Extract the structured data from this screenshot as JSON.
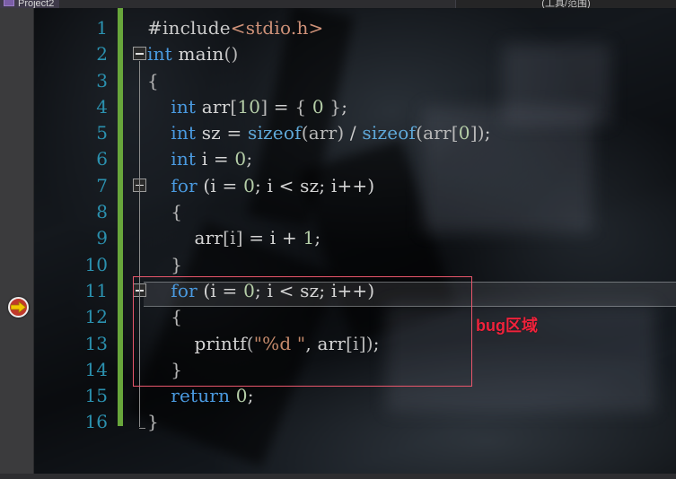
{
  "window": {
    "tab_label": "Project2",
    "tab_icon": "solution-icon",
    "right_panel_label": "(工具/范围)"
  },
  "editor": {
    "theme": "dark-with-background-image",
    "language": "C",
    "line_numbers": [
      "1",
      "2",
      "3",
      "4",
      "5",
      "6",
      "7",
      "8",
      "9",
      "10",
      "11",
      "12",
      "13",
      "14",
      "15",
      "16"
    ],
    "current_execution_line": 11,
    "breakpoint_line": 11,
    "lines": [
      {
        "n": 1,
        "indent": 0,
        "tokens": [
          {
            "t": "#include",
            "c": "pp"
          },
          {
            "t": "<stdio.h>",
            "c": "inc"
          }
        ]
      },
      {
        "n": 2,
        "indent": 0,
        "tokens": [
          {
            "t": "int",
            "c": "kw"
          },
          {
            "t": " ",
            "c": "plain"
          },
          {
            "t": "main",
            "c": "plain"
          },
          {
            "t": "()",
            "c": "brk"
          }
        ]
      },
      {
        "n": 3,
        "indent": 0,
        "tokens": [
          {
            "t": "{",
            "c": "brk"
          }
        ]
      },
      {
        "n": 4,
        "indent": 1,
        "tokens": [
          {
            "t": "int",
            "c": "kw"
          },
          {
            "t": " arr",
            "c": "plain"
          },
          {
            "t": "[",
            "c": "brk"
          },
          {
            "t": "10",
            "c": "num"
          },
          {
            "t": "]",
            "c": "brk"
          },
          {
            "t": " = ",
            "c": "op"
          },
          {
            "t": "{ ",
            "c": "brk"
          },
          {
            "t": "0",
            "c": "num"
          },
          {
            "t": " }",
            "c": "brk"
          },
          {
            "t": ";",
            "c": "op"
          }
        ]
      },
      {
        "n": 5,
        "indent": 1,
        "tokens": [
          {
            "t": "int",
            "c": "kw"
          },
          {
            "t": " sz = ",
            "c": "plain"
          },
          {
            "t": "sizeof",
            "c": "fn"
          },
          {
            "t": "(arr)",
            "c": "brk"
          },
          {
            "t": " / ",
            "c": "op"
          },
          {
            "t": "sizeof",
            "c": "fn"
          },
          {
            "t": "(arr",
            "c": "brk"
          },
          {
            "t": "[",
            "c": "brk"
          },
          {
            "t": "0",
            "c": "num"
          },
          {
            "t": "])",
            "c": "brk"
          },
          {
            "t": ";",
            "c": "op"
          }
        ]
      },
      {
        "n": 6,
        "indent": 1,
        "tokens": [
          {
            "t": "int",
            "c": "kw"
          },
          {
            "t": " i = ",
            "c": "plain"
          },
          {
            "t": "0",
            "c": "num"
          },
          {
            "t": ";",
            "c": "op"
          }
        ]
      },
      {
        "n": 7,
        "indent": 1,
        "tokens": [
          {
            "t": "for",
            "c": "kw"
          },
          {
            "t": " (i = ",
            "c": "plain"
          },
          {
            "t": "0",
            "c": "num"
          },
          {
            "t": "; i < sz; i++)",
            "c": "plain"
          }
        ]
      },
      {
        "n": 8,
        "indent": 1,
        "tokens": [
          {
            "t": "{",
            "c": "brk"
          }
        ]
      },
      {
        "n": 9,
        "indent": 2,
        "tokens": [
          {
            "t": "arr",
            "c": "plain"
          },
          {
            "t": "[i]",
            "c": "brk"
          },
          {
            "t": " = i + ",
            "c": "plain"
          },
          {
            "t": "1",
            "c": "num"
          },
          {
            "t": ";",
            "c": "op"
          }
        ]
      },
      {
        "n": 10,
        "indent": 1,
        "tokens": [
          {
            "t": "}",
            "c": "brk"
          }
        ]
      },
      {
        "n": 11,
        "indent": 1,
        "tokens": [
          {
            "t": "for",
            "c": "kw"
          },
          {
            "t": " (i = ",
            "c": "plain"
          },
          {
            "t": "0",
            "c": "num"
          },
          {
            "t": "; i < sz; i++)",
            "c": "plain"
          }
        ]
      },
      {
        "n": 12,
        "indent": 1,
        "tokens": [
          {
            "t": "{",
            "c": "brk"
          }
        ]
      },
      {
        "n": 13,
        "indent": 2,
        "tokens": [
          {
            "t": "printf",
            "c": "plain"
          },
          {
            "t": "(",
            "c": "brk"
          },
          {
            "t": "\"%d \"",
            "c": "str"
          },
          {
            "t": ", arr",
            "c": "plain"
          },
          {
            "t": "[i]",
            "c": "brk"
          },
          {
            "t": ")",
            "c": "brk"
          },
          {
            "t": ";",
            "c": "op"
          }
        ]
      },
      {
        "n": 14,
        "indent": 1,
        "tokens": [
          {
            "t": "}",
            "c": "brk"
          }
        ]
      },
      {
        "n": 15,
        "indent": 1,
        "tokens": [
          {
            "t": "return",
            "c": "kw"
          },
          {
            "t": " ",
            "c": "plain"
          },
          {
            "t": "0",
            "c": "num"
          },
          {
            "t": ";",
            "c": "op"
          }
        ]
      },
      {
        "n": 16,
        "indent": 0,
        "tokens": [
          {
            "t": "}",
            "c": "brk"
          }
        ]
      }
    ],
    "fold_markers": [
      {
        "line": 2,
        "state": "expanded"
      },
      {
        "line": 7,
        "state": "expanded"
      },
      {
        "line": 11,
        "state": "expanded"
      }
    ]
  },
  "annotation": {
    "label": "bug区域",
    "color": "#f0233c",
    "box_color": "#e8566b",
    "covers_lines": [
      11,
      12,
      13,
      14
    ]
  },
  "colors": {
    "keyword": "#4a9ae0",
    "function": "#5fa8d8",
    "number": "#b5cea8",
    "string": "#c58a6b",
    "include": "#ce9178",
    "line_number": "#2b91af",
    "change_bar": "#68a63b",
    "gutter": "#3b3b3d",
    "tab_active": "#3f3a4a",
    "breakpoint": "#c0392b",
    "exec_arrow": "#f2c500"
  }
}
